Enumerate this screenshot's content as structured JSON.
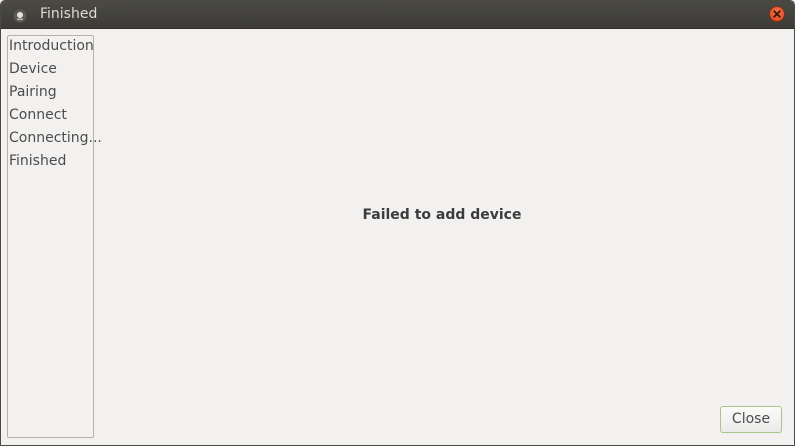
{
  "window": {
    "title": "Finished"
  },
  "sidebar": {
    "items": [
      {
        "label": "Introduction"
      },
      {
        "label": "Device"
      },
      {
        "label": "Pairing"
      },
      {
        "label": "Connect"
      },
      {
        "label": "Connecting..."
      },
      {
        "label": "Finished"
      }
    ]
  },
  "main": {
    "message": "Failed to add device"
  },
  "footer": {
    "close_label": "Close"
  },
  "colors": {
    "titlebar": "#3c3b37",
    "window_bg": "#f2f1f0",
    "close_accent": "#df4a1f"
  },
  "icons": {
    "app": "bluetooth-wizard-icon",
    "window_close": "close-icon"
  }
}
